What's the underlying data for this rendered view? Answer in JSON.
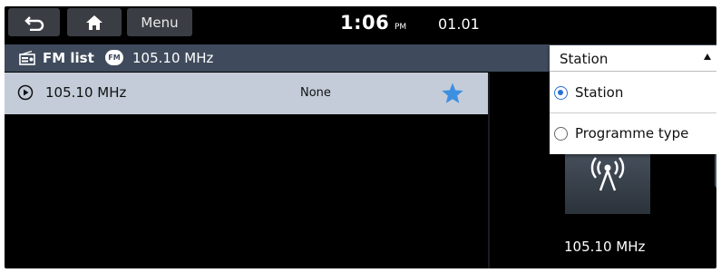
{
  "top_bar": {
    "menu_label": "Menu",
    "time": "1:06",
    "ampm": "PM",
    "date": "01.01"
  },
  "list_header": {
    "title": "FM list",
    "badge": "FM",
    "frequency": "105.10 MHz"
  },
  "station_list": [
    {
      "frequency": "105.10 MHz",
      "programme_type": "None",
      "favorite": true
    }
  ],
  "now_playing": {
    "frequency": "105.10 MHz"
  },
  "sort_dropdown": {
    "selected": "Station",
    "options": [
      {
        "label": "Station",
        "checked": true
      },
      {
        "label": "Programme type",
        "checked": false
      }
    ]
  },
  "colors": {
    "header_bg": "#3f4b5c",
    "selected_row_bg": "#c4ccd9",
    "star": "#3d8fe0",
    "radio_accent": "#2b6fd6"
  }
}
